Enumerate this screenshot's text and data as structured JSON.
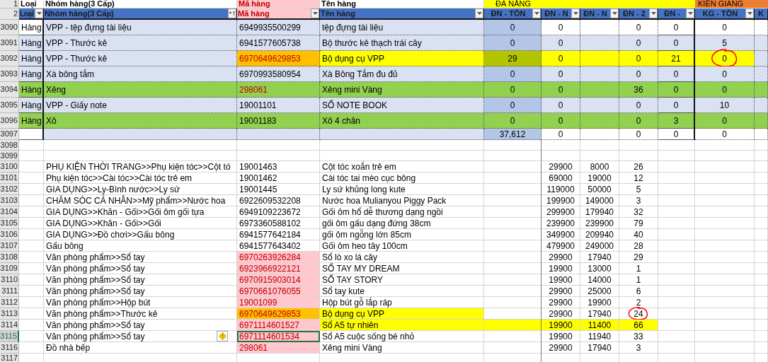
{
  "header_row_1": {
    "row_number": "1",
    "cells": [
      "Loại",
      "Nhóm hàng(3 Cấp)",
      "Mã hàng",
      "Tên hàng"
    ],
    "groups": [
      {
        "label": "ĐÀ NẴNG",
        "kind": "danang"
      },
      {
        "label": "KIÊN GIANG",
        "kind": "kiengiang"
      }
    ]
  },
  "header_row_2": {
    "row_number": "2",
    "columns": [
      {
        "label": "Loại",
        "kind": "filter"
      },
      {
        "label": "Nhóm hàng(3 Cấp)",
        "kind": "sorted"
      },
      {
        "label": "Mã hàng",
        "kind": "filter"
      },
      {
        "label": "Tên hàng",
        "kind": "filter"
      },
      {
        "label": "ĐN - TỒN",
        "kind": "filter"
      },
      {
        "label": "ĐN - N",
        "kind": "filter"
      },
      {
        "label": "ĐN - N",
        "kind": "filter"
      },
      {
        "label": "ĐN - 2",
        "kind": "filter"
      },
      {
        "label": "ĐN -",
        "kind": "filter"
      },
      {
        "label": "KG - TỒN",
        "kind": "filter"
      },
      {
        "label": "K",
        "kind": "plain"
      }
    ]
  },
  "top_rows": [
    {
      "row_number": "3090",
      "banded": false,
      "green": false,
      "duplicate": false,
      "marked": false,
      "highlighter": false,
      "cells": [
        "Hàng",
        "VPP - tệp đựng tài liệu",
        "6949935500299",
        "tệp đựng tài liệu",
        "0",
        "0",
        "",
        "0",
        "0",
        "0"
      ]
    },
    {
      "row_number": "3091",
      "banded": true,
      "green": false,
      "duplicate": false,
      "marked": false,
      "highlighter": false,
      "cells": [
        "Hàng",
        "VPP - Thước kẻ",
        "6941577605738",
        "Bộ thước kẻ thạch trái cây",
        "0",
        "0",
        "",
        "0",
        "0",
        "5"
      ]
    },
    {
      "row_number": "3092",
      "banded": true,
      "green": false,
      "duplicate": true,
      "marked": true,
      "highlighter": true,
      "cells": [
        "Hàng",
        "VPP - Thước kẻ",
        "6970649629853",
        "Bộ dụng cụ VPP",
        "29",
        "0",
        "",
        "0",
        "21",
        {
          "text": "0",
          "circled": true
        }
      ]
    },
    {
      "row_number": "3093",
      "banded": true,
      "green": false,
      "duplicate": false,
      "marked": false,
      "highlighter": false,
      "cells": [
        "Hàng",
        "Xà bông tắm",
        "6970993580954",
        "Xà Bông Tắm đu đủ",
        "0",
        "0",
        "",
        "0",
        "0",
        "0"
      ]
    },
    {
      "row_number": "3094",
      "banded": false,
      "green": true,
      "duplicate": true,
      "marked": false,
      "highlighter": false,
      "cells": [
        "Hàng",
        "Xẻng",
        "298061",
        "Xẻng mini Vàng",
        "0",
        "0",
        "",
        "36",
        "0",
        "0"
      ]
    },
    {
      "row_number": "3095",
      "banded": true,
      "green": false,
      "duplicate": false,
      "marked": false,
      "highlighter": false,
      "cells": [
        "Hàng",
        "VPP - Giấy note",
        "19001101",
        "SỔ NOTE BOOK",
        "0",
        "0",
        "",
        "0",
        "0",
        "10"
      ]
    },
    {
      "row_number": "3096",
      "banded": false,
      "green": true,
      "duplicate": false,
      "marked": false,
      "highlighter": false,
      "cells": [
        "Hàng",
        "Xô",
        "19001183",
        "Xô 4 chân",
        "0",
        "0",
        "",
        "0",
        "3",
        "0"
      ]
    },
    {
      "row_number": "3097",
      "banded": false,
      "green": false,
      "duplicate": false,
      "marked": false,
      "highlighter": false,
      "cells": [
        "",
        "",
        "",
        "",
        "37,612",
        "0",
        "",
        "0",
        "0",
        "0"
      ]
    }
  ],
  "empty_rows": [
    "3098",
    "3099"
  ],
  "bottom_rows": [
    {
      "row_number": "3100",
      "duplicate": false,
      "marked": false,
      "name_highlighted": false,
      "row_highlighted": false,
      "selected": false,
      "cells": [
        "PHỤ KIỆN THỜI TRANG>>Phụ kiện tóc>>Cột tó",
        "19001463",
        "Cột tóc xoắn trẻ em",
        "29900",
        "8000",
        "26"
      ]
    },
    {
      "row_number": "3101",
      "duplicate": false,
      "marked": false,
      "name_highlighted": false,
      "row_highlighted": false,
      "selected": false,
      "cells": [
        "Phụ kiện tóc>>Cài tóc>>Cài tóc trẻ em",
        "19001462",
        "Cài tóc tai mèo cục bông",
        "69000",
        "19000",
        "12"
      ]
    },
    {
      "row_number": "3102",
      "duplicate": false,
      "marked": false,
      "name_highlighted": false,
      "row_highlighted": false,
      "selected": false,
      "cells": [
        "GIA DỤNG>>Ly-Bình nước>>Ly sứ",
        "19001445",
        "Ly sứ khủng long kute",
        "119000",
        "50000",
        "5"
      ]
    },
    {
      "row_number": "3103",
      "duplicate": false,
      "marked": false,
      "name_highlighted": false,
      "row_highlighted": false,
      "selected": false,
      "cells": [
        "CHĂM SÓC CÁ NHÂN>>Mỹ phẩm>>Nước hoa",
        "6922609532208",
        "Nước hoa Mulianyou Piggy Pack",
        "199900",
        "149000",
        "3"
      ]
    },
    {
      "row_number": "3104",
      "duplicate": false,
      "marked": false,
      "name_highlighted": false,
      "row_highlighted": false,
      "selected": false,
      "cells": [
        "GIA DỤNG>>Khăn - Gối>>Gối ôm gối tựa",
        "6949109223672",
        "Gối ôm hổ dễ thương dạng ngồi",
        "299900",
        "179940",
        "32"
      ]
    },
    {
      "row_number": "3105",
      "duplicate": false,
      "marked": false,
      "name_highlighted": false,
      "row_highlighted": false,
      "selected": false,
      "cells": [
        "GIA DỤNG>>Khăn - Gối>>Gối",
        "6973360588102",
        "gối ôm gấu dạng đứng 38cm",
        "239900",
        "239900",
        "79"
      ]
    },
    {
      "row_number": "3106",
      "duplicate": false,
      "marked": false,
      "name_highlighted": false,
      "row_highlighted": false,
      "selected": false,
      "cells": [
        "GIA DỤNG>>Đồ chơi>>Gấu bông",
        "6941577642184",
        "gối ôm ngỗng lớn 85cm",
        "349900",
        "209940",
        "40"
      ]
    },
    {
      "row_number": "3107",
      "duplicate": false,
      "marked": false,
      "name_highlighted": false,
      "row_highlighted": false,
      "selected": false,
      "cells": [
        "Gấu bông",
        "6941577643402",
        "Gối ôm heo tây 100cm",
        "479900",
        "249000",
        "28"
      ]
    },
    {
      "row_number": "3108",
      "duplicate": true,
      "marked": false,
      "name_highlighted": false,
      "row_highlighted": false,
      "selected": false,
      "cells": [
        "Văn phòng phẩm>>Sổ tay",
        "6970263926284",
        "Sổ lò xo lá cây",
        "29900",
        "17940",
        "29"
      ]
    },
    {
      "row_number": "3109",
      "duplicate": true,
      "marked": false,
      "name_highlighted": false,
      "row_highlighted": false,
      "selected": false,
      "cells": [
        "Văn phòng phẩm>>Sổ tay",
        "6923966922121",
        "SỔ TAY MY DREAM",
        "19900",
        "13000",
        "1"
      ]
    },
    {
      "row_number": "3110",
      "duplicate": true,
      "marked": false,
      "name_highlighted": false,
      "row_highlighted": false,
      "selected": false,
      "cells": [
        "Văn phòng phẩm>>Sổ tay",
        "6970915903014",
        "SỔ TAY STORY",
        "19900",
        "14000",
        "1"
      ]
    },
    {
      "row_number": "3111",
      "duplicate": true,
      "marked": false,
      "name_highlighted": false,
      "row_highlighted": false,
      "selected": false,
      "cells": [
        "Văn phòng phẩm>>Sổ tay",
        "6970661076055",
        "Sổ tay kute",
        "29900",
        "25000",
        "6"
      ]
    },
    {
      "row_number": "3112",
      "duplicate": true,
      "marked": false,
      "name_highlighted": false,
      "row_highlighted": false,
      "selected": false,
      "cells": [
        "Văn phòng phẩm>>Hộp bút",
        "19001099",
        "Hộp bút gỗ lắp ráp",
        "29900",
        "19900",
        "2"
      ]
    },
    {
      "row_number": "3113",
      "duplicate": true,
      "marked": true,
      "name_highlighted": true,
      "row_highlighted": false,
      "selected": false,
      "cells": [
        "Văn phòng phẩm>>Thước kẻ",
        "6970649629853",
        "Bộ dụng cụ VPP",
        "29900",
        "17940",
        {
          "text": "24",
          "circled": true
        }
      ]
    },
    {
      "row_number": "3114",
      "duplicate": true,
      "marked": false,
      "name_highlighted": false,
      "row_highlighted": true,
      "selected": false,
      "cells": [
        "Văn phòng phẩm>>Sổ tay",
        "6971114601527",
        "Sổ A5 tự nhiên",
        "19900",
        "11400",
        "66"
      ]
    },
    {
      "row_number": "3115",
      "duplicate": true,
      "marked": false,
      "name_highlighted": false,
      "row_highlighted": false,
      "selected": true,
      "cells": [
        "Văn phòng phẩm>>Sổ tay",
        "6971114601534",
        "Sổ A5 cuộc sống bé nhỏ",
        "19900",
        "11940",
        "33"
      ]
    },
    {
      "row_number": "3116",
      "duplicate": true,
      "marked": false,
      "name_highlighted": false,
      "row_highlighted": false,
      "selected": false,
      "cells": [
        "Đồ nhà bếp",
        "298061",
        "Xẻng mini Vàng",
        "29900",
        "17940",
        "3"
      ]
    }
  ],
  "last_row": "3117"
}
